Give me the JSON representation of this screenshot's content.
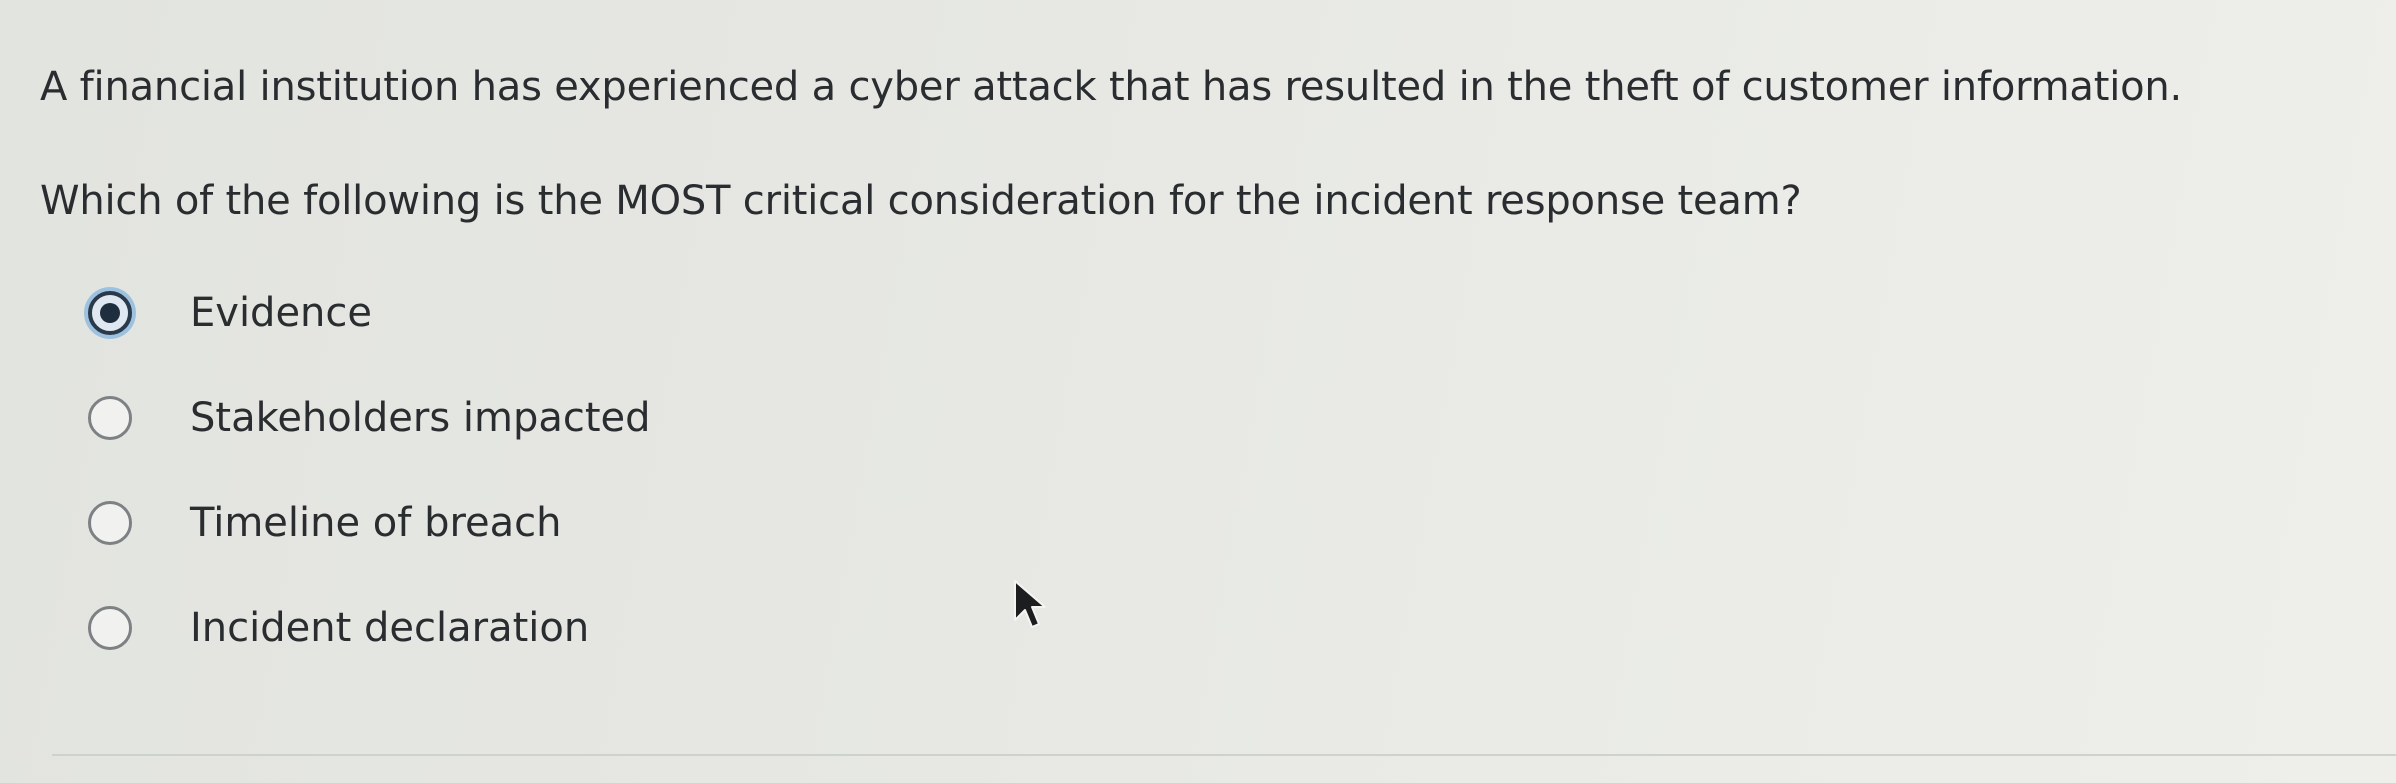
{
  "question": {
    "stem_line_1": "A financial institution has experienced a cyber attack that has resulted in the theft of customer information.",
    "stem_line_2": "Which of the following is the MOST critical consideration for the incident response team?",
    "selected_option": "Evidence",
    "options": [
      {
        "label": "Evidence",
        "selected": true
      },
      {
        "label": "Stakeholders impacted",
        "selected": false
      },
      {
        "label": "Timeline of breach",
        "selected": false
      },
      {
        "label": "Incident declaration",
        "selected": false
      }
    ]
  },
  "icons": {
    "selected_radio": "radio-selected-icon",
    "unselected_radio": "radio-unselected-icon",
    "cursor": "mouse-pointer-icon"
  },
  "colors": {
    "text": "#2a2d30",
    "radio_border": "#7d8184",
    "radio_selected_fill": "#1f2e3e",
    "radio_focus_ring": "#9dc2df",
    "background": "#e6e7e3"
  }
}
